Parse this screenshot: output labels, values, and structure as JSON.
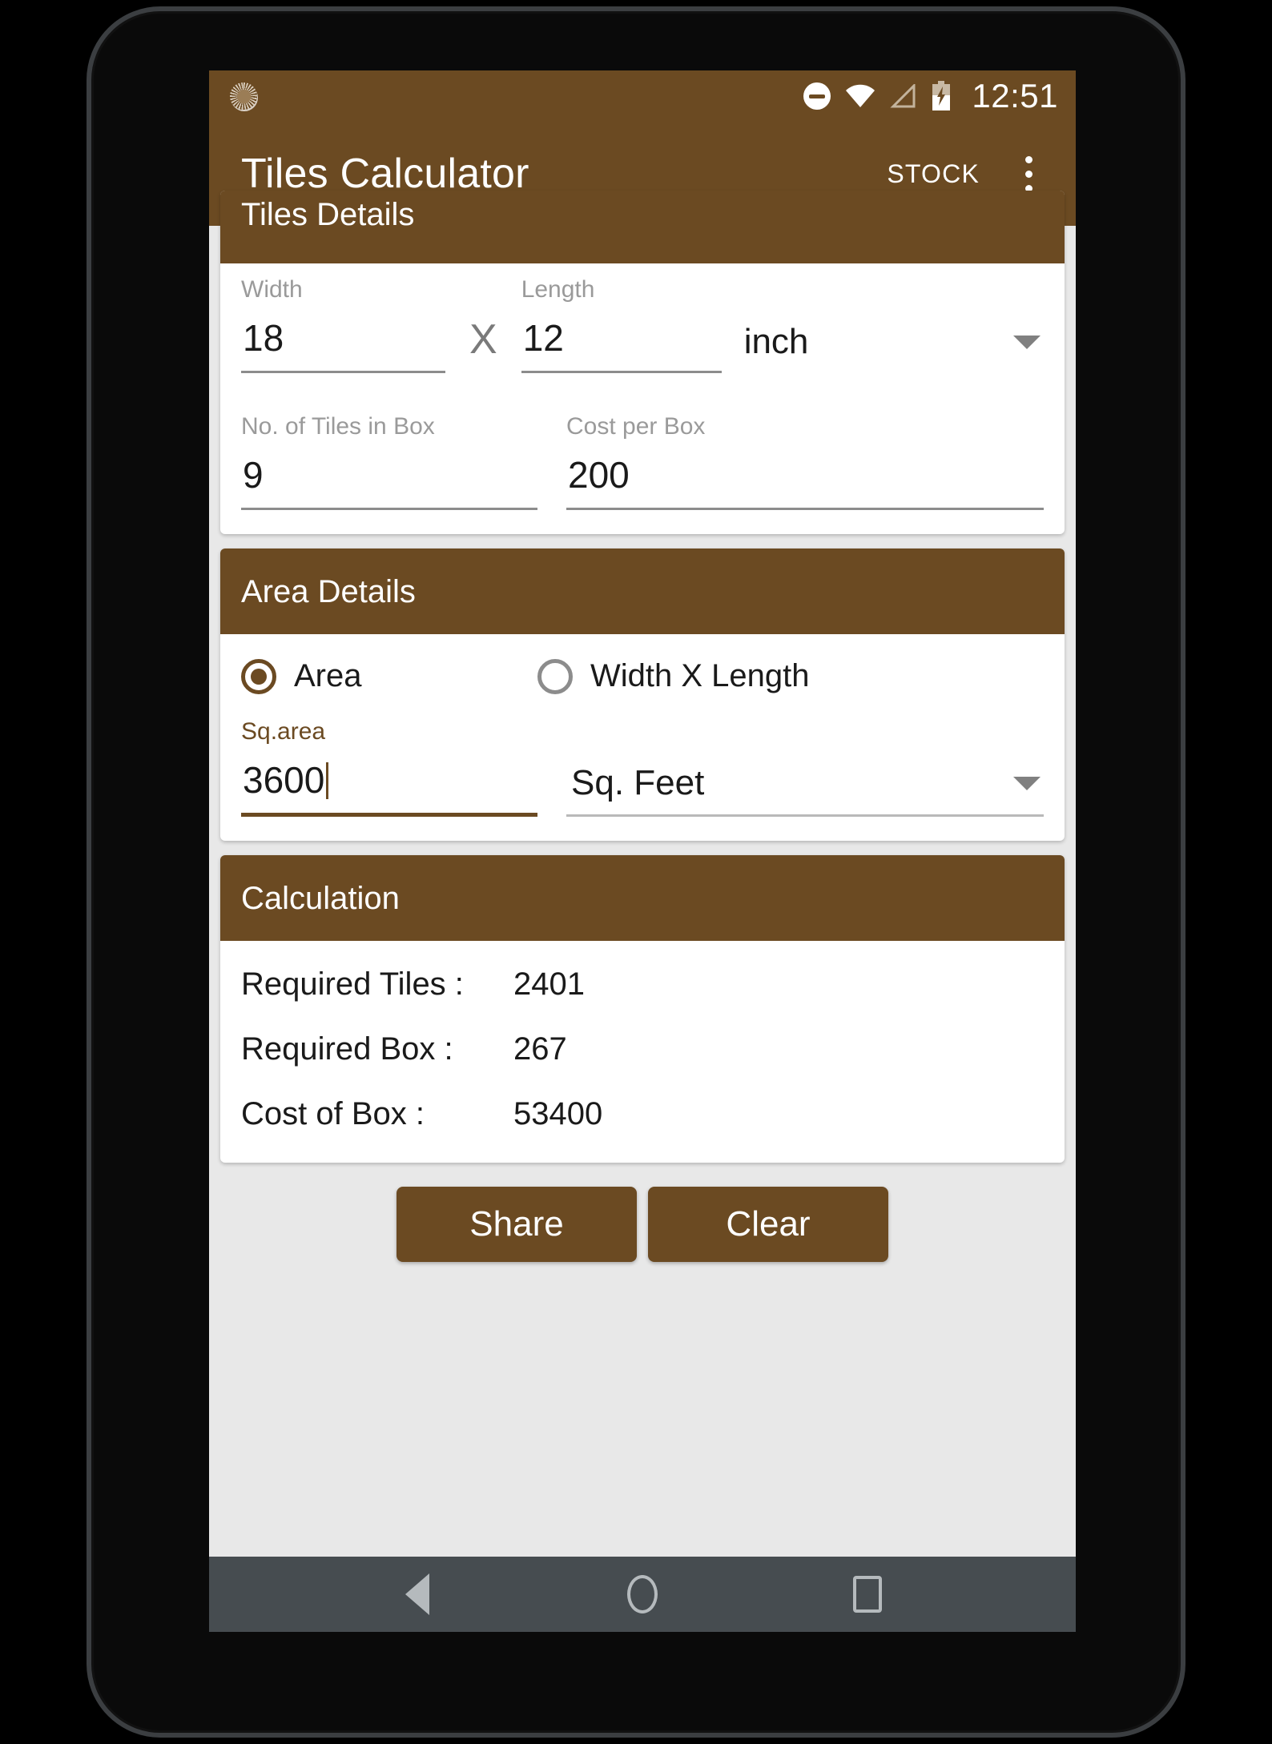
{
  "status_bar": {
    "sync_icon": "sync-icon",
    "dnd_icon": "do-not-disturb-icon",
    "wifi_icon": "wifi-icon",
    "signal_icon": "cell-signal-empty-icon",
    "battery_icon": "battery-charging-icon",
    "time": "12:51"
  },
  "app_bar": {
    "title": "Tiles Calculator",
    "stock_label": "STOCK",
    "overflow_icon": "overflow-menu-icon"
  },
  "tiles_details": {
    "header": "Tiles Details",
    "width_label": "Width",
    "width_value": "18",
    "multiply_symbol": "X",
    "length_label": "Length",
    "length_value": "12",
    "unit_value": "inch",
    "tiles_in_box_label": "No. of Tiles in Box",
    "tiles_in_box_value": "9",
    "cost_per_box_label": "Cost per Box",
    "cost_per_box_value": "200"
  },
  "area_details": {
    "header": "Area Details",
    "radio_area_label": "Area",
    "radio_wxl_label": "Width X Length",
    "selected_mode": "Area",
    "sq_area_label": "Sq.area",
    "sq_area_value": "3600",
    "area_unit_value": "Sq. Feet"
  },
  "calculation": {
    "header": "Calculation",
    "rows": [
      {
        "key": "Required Tiles :",
        "value": "2401"
      },
      {
        "key": "Required Box :",
        "value": "267"
      },
      {
        "key": "Cost of Box :",
        "value": "53400"
      }
    ]
  },
  "buttons": {
    "share_label": "Share",
    "clear_label": "Clear"
  },
  "nav_bar": {
    "back_icon": "back-triangle-icon",
    "home_icon": "home-circle-icon",
    "recents_icon": "recents-square-icon"
  },
  "colors": {
    "primary_brown": "#6b4a22",
    "screen_background": "#e8e8e8",
    "nav_bar": "#464c50"
  }
}
